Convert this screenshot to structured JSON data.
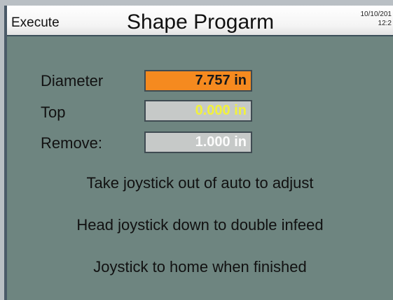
{
  "header": {
    "mode": "Execute",
    "title": "Shape Progarm",
    "date": "10/10/201",
    "time": "12:2"
  },
  "fields": {
    "diameter": {
      "label": "Diameter",
      "value": "7.757 in"
    },
    "top": {
      "label": "Top",
      "value": "0.000 in"
    },
    "remove": {
      "label": "Remove:",
      "value": "1.000 in"
    }
  },
  "messages": [
    "Take joystick out of auto to adjust",
    "Head joystick down to double infeed",
    "Joystick to home when finished"
  ],
  "colors": {
    "background": "#6e8580",
    "diameter_field": "#f58a1f",
    "top_value_text": "#f2f23a",
    "remove_value_text": "#fbfbfb"
  }
}
